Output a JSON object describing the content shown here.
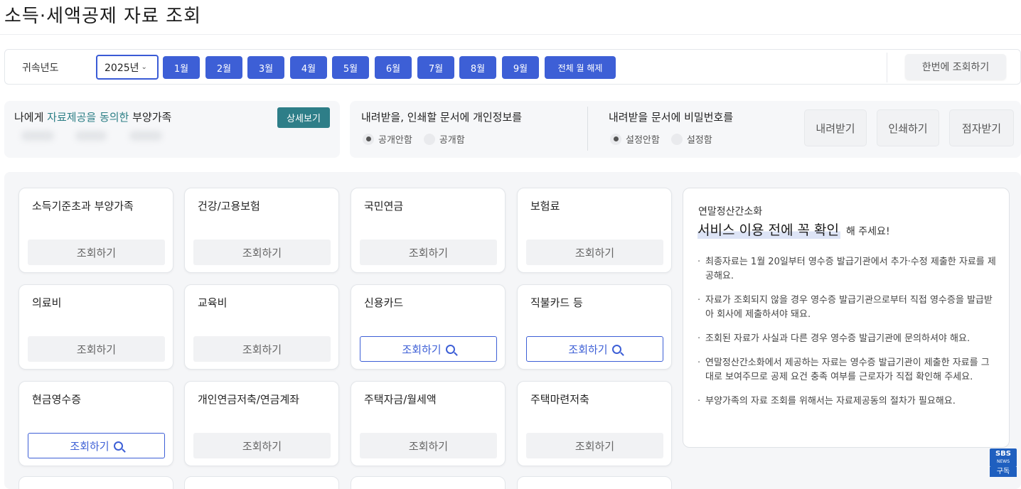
{
  "page": {
    "title": "소득·세액공제 자료 조회"
  },
  "toolbar": {
    "year_label": "귀속년도",
    "year_value": "2025년",
    "months": [
      "1월",
      "2월",
      "3월",
      "4월",
      "5월",
      "6월",
      "7월",
      "8월",
      "9월"
    ],
    "clear_label": "전체 월 해제",
    "query_all_label": "한번에 조회하기"
  },
  "dependents": {
    "title_pre": "나에게 ",
    "title_accent": "자료제공을 동의한",
    "title_post": " 부양가족",
    "detail_label": "상세보기",
    "accent_color": "#2d7f86"
  },
  "privacy": {
    "personal_info_heading": "내려받을, 인쇄할 문서에 개인정보를",
    "personal_info_options": [
      "공개안함",
      "공개함"
    ],
    "personal_info_selected": "공개안함",
    "password_heading": "내려받을 문서에 비밀번호를",
    "password_options": [
      "설정안함",
      "설정함"
    ],
    "password_selected": "설정안함",
    "actions": [
      "내려받기",
      "인쇄하기",
      "점자받기"
    ]
  },
  "cards": [
    {
      "title": "소득기준초과 부양가족",
      "button": "조회하기",
      "enabled": false
    },
    {
      "title": "건강/고용보험",
      "button": "조회하기",
      "enabled": false
    },
    {
      "title": "국민연금",
      "button": "조회하기",
      "enabled": false
    },
    {
      "title": "보험료",
      "button": "조회하기",
      "enabled": false
    },
    {
      "title": "의료비",
      "button": "조회하기",
      "enabled": false
    },
    {
      "title": "교육비",
      "button": "조회하기",
      "enabled": false
    },
    {
      "title": "신용카드",
      "button": "조회하기",
      "enabled": true
    },
    {
      "title": "직불카드 등",
      "button": "조회하기",
      "enabled": true
    },
    {
      "title": "현금영수증",
      "button": "조회하기",
      "enabled": true
    },
    {
      "title": "개인연금저축/연금계좌",
      "button": "조회하기",
      "enabled": false
    },
    {
      "title": "주택자금/월세액",
      "button": "조회하기",
      "enabled": false
    },
    {
      "title": "주택마련저축",
      "button": "조회하기",
      "enabled": false
    }
  ],
  "notice": {
    "subtitle": "연말정산간소화",
    "headline": "서비스 이용 전에 꼭 확인",
    "headline_suffix": "해 주세요!",
    "items": [
      "최종자료는 1월 20일부터 영수증 발급기관에서 추가·수정 제출한 자료를 제공해요.",
      "자료가 조회되지 않을 경우 영수증 발급기관으로부터 직접 영수증을 발급받아 회사에 제출하셔야 돼요.",
      "조회된 자료가 사실과 다른 경우 영수증 발급기관에 문의하셔야 해요.",
      "연말정산간소화에서 제공하는 자료는 영수증 발급기관이 제출한 자료를 그대로 보여주므로 공제 요건 충족 여부를 근로자가 직접 확인해 주세요.",
      "부양가족의 자료 조회를 위해서는 자료제공동의 절차가 필요해요."
    ]
  },
  "overlay": {
    "logo_text": "SBS",
    "logo_sub": "NEWS",
    "badge": "구독"
  },
  "colors": {
    "primary": "#3d5fd6",
    "teal": "#2e7e88"
  }
}
